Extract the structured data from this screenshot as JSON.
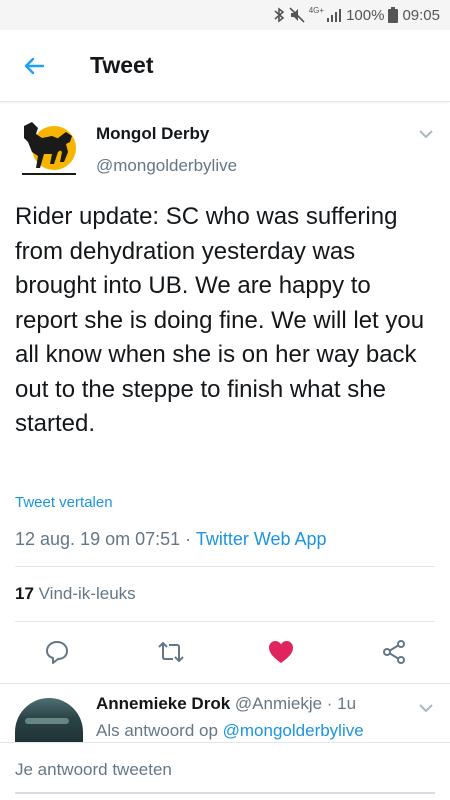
{
  "status_bar": {
    "network_label": "4G+",
    "battery": "100%",
    "time": "09:05",
    "icons": [
      "bluetooth-icon",
      "mute-icon",
      "signal-icon",
      "battery-icon"
    ]
  },
  "header": {
    "title": "Tweet",
    "back_icon": "arrow-left-icon"
  },
  "tweet": {
    "author_name": "Mongol Derby",
    "author_handle": "@mongolderbylive",
    "text": "Rider update: SC who was suffering from dehydration yesterday was brought into UB. We are happy to report she is doing fine. We will let you all know when she is on her way back out to the steppe to finish what she started.",
    "translate_label": "Tweet vertalen",
    "timestamp": "12 aug. 19 om 07:51 · ",
    "source": "Twitter Web App",
    "like_count": "17",
    "like_label": " Vind-ik-leuks",
    "liked": true
  },
  "actions": [
    "reply-icon",
    "retweet-icon",
    "like-heart-icon",
    "share-icon"
  ],
  "reply": {
    "author_name": "Annemieke Drok",
    "author_meta": " @Anmiekje · 1u",
    "replying_prefix": "Als antwoord op ",
    "replying_to": "@mongolderbylive"
  },
  "composer": {
    "placeholder": "Je antwoord tweeten"
  },
  "colors": {
    "accent": "#1b95e0",
    "like": "#e0245e",
    "muted": "#657786",
    "text": "#14171a",
    "logo_yellow": "#f7b500"
  }
}
